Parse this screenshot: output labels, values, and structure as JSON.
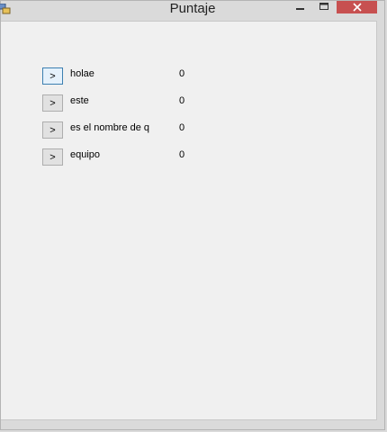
{
  "window": {
    "title": "Puntaje",
    "close_glyph": "✕",
    "accent_close": "#c75050"
  },
  "rows": [
    {
      "button_label": ">",
      "name": "holae",
      "score": "0"
    },
    {
      "button_label": ">",
      "name": "este",
      "score": "0"
    },
    {
      "button_label": ">",
      "name": "es el nombre de q",
      "score": "0"
    },
    {
      "button_label": ">",
      "name": "equipo",
      "score": "0"
    }
  ]
}
